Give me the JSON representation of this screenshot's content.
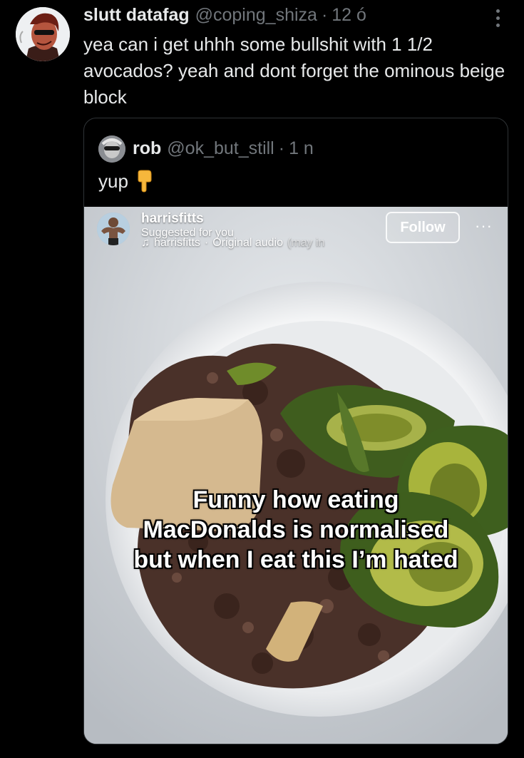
{
  "tweet": {
    "display_name": "slutt datafag",
    "handle": "@coping_shiza",
    "separator": "·",
    "time": "12 ó",
    "text": "yea can i get uhhh some bullshit with 1 1/2 avocados? yeah and dont forget the ominous beige block"
  },
  "quote": {
    "display_name": "rob",
    "handle": "@ok_but_still",
    "separator": "·",
    "time": "1 n",
    "text": "yup",
    "emoji": "pointing-down-hand-emoji"
  },
  "media": {
    "username": "harrisfitts",
    "suggested": "Suggested for you",
    "audio_user": "harrisfitts",
    "audio_sep": "·",
    "audio_title": "Original audio",
    "audio_extra": "(may in",
    "follow_label": "Follow",
    "more_label": "···",
    "caption_line1": "Funny how eating",
    "caption_line2": "MacDonalds is normalised",
    "caption_line3": "but when I eat this I’m hated"
  }
}
